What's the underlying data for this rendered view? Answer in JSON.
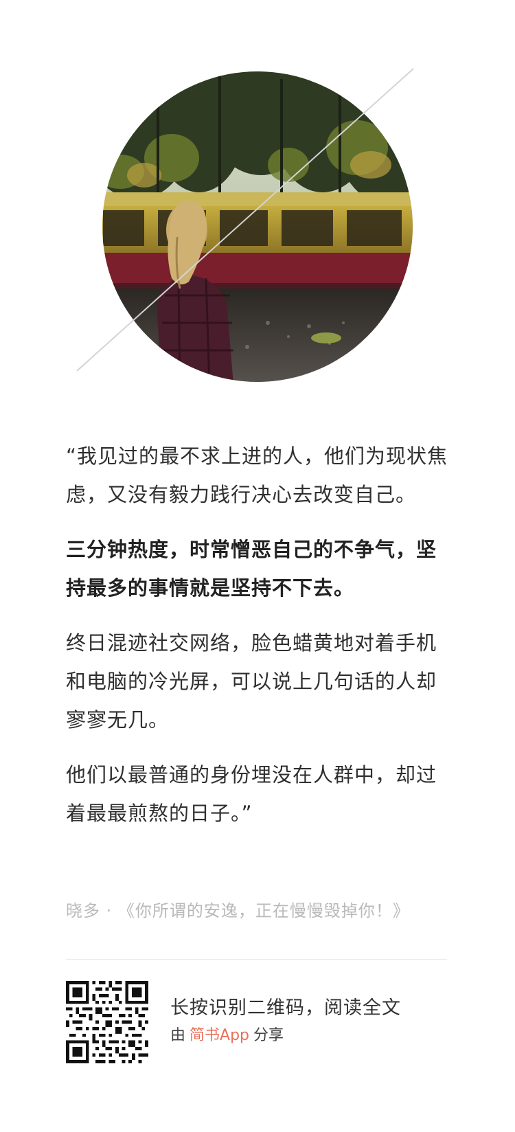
{
  "quote": {
    "paragraphs": [
      {
        "text": "“我见过的最不求上进的人，他们为现状焦虑，又没有毅力践行决心去改变自己。",
        "bold": false
      },
      {
        "text": "三分钟热度，时常憎恶自己的不争气，坚持最多的事情就是坚持不下去。",
        "bold": true
      },
      {
        "text": "终日混迹社交网络，脸色蜡黄地对着手机和电脑的冷光屏，可以说上几句话的人却寥寥无几。",
        "bold": false
      },
      {
        "text": "他们以最普通的身份埋没在人群中，却过着最最煎熬的日子。”",
        "bold": false
      }
    ],
    "source": "晓多 · 《你所谓的安逸，正在慢慢毁掉你！》"
  },
  "share": {
    "line1": "长按识别二维码，阅读全文",
    "prefix": "由",
    "app_name": "简书App",
    "suffix": "分享"
  },
  "icons": {
    "qr": "qr-code-icon"
  },
  "colors": {
    "brand": "#ea6f5a",
    "source_text": "#b9b9b9",
    "body_text": "#2f2f2f"
  }
}
